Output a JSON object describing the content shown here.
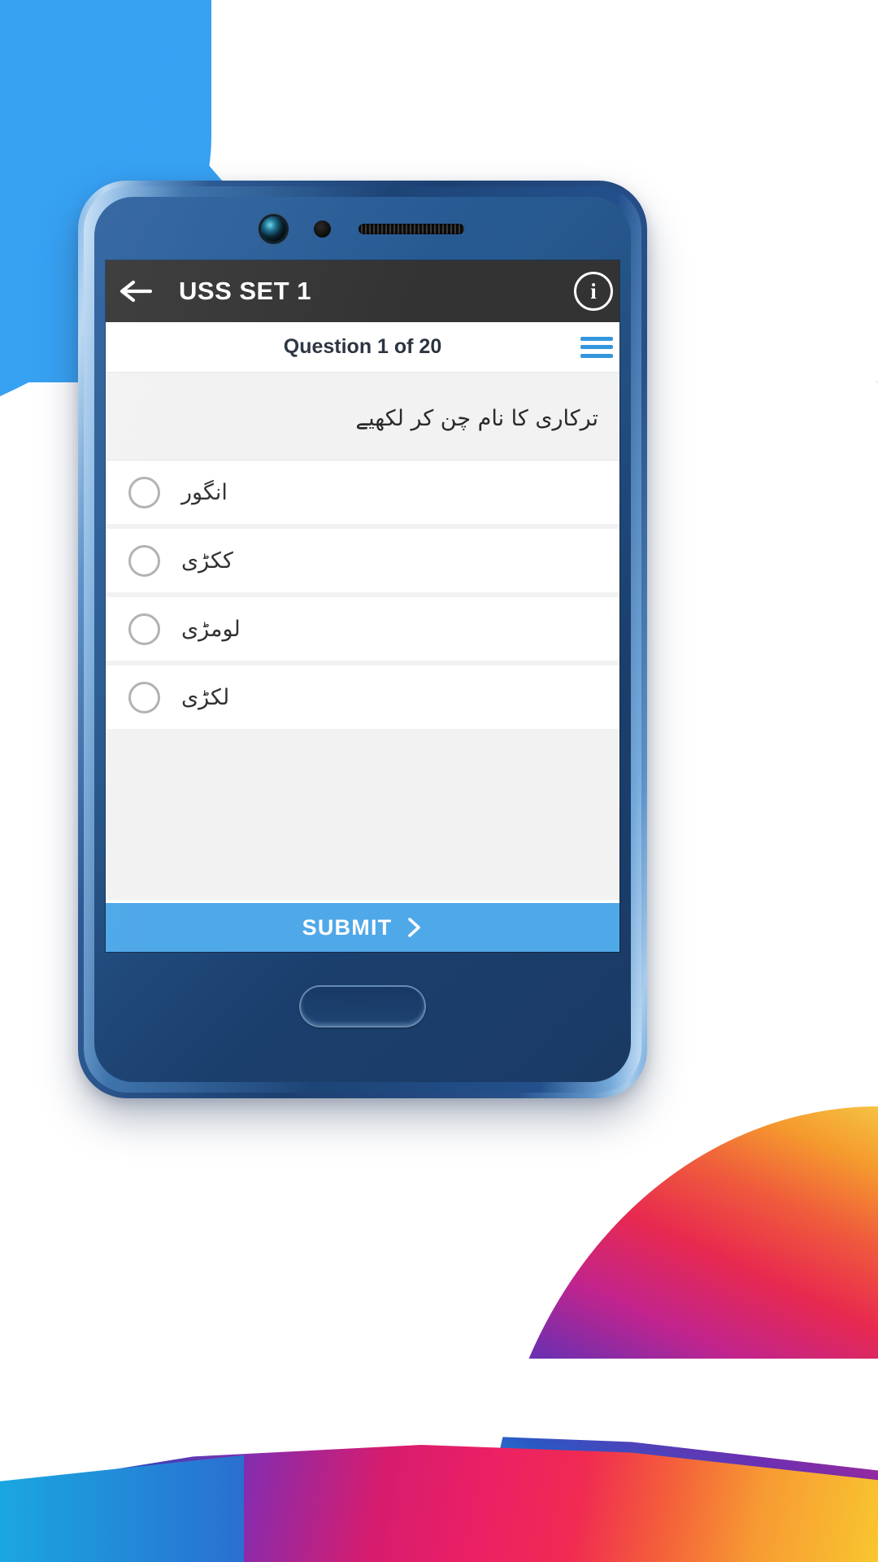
{
  "app": {
    "toolbar": {
      "back_icon": "arrow-left-icon",
      "title": "USS SET 1",
      "info_icon": "i",
      "background_color": "#333333"
    },
    "question_bar": {
      "counter_text": "Question 1 of 20",
      "menu_icon": "hamburger-icon",
      "menu_color": "#3397dd"
    },
    "question": {
      "text": "ترکاری کا نام چن کر لکھیے",
      "direction": "rtl"
    },
    "options": [
      {
        "id": "option-1",
        "label": "انگور",
        "selected": false
      },
      {
        "id": "option-2",
        "label": "ککڑی",
        "selected": false
      },
      {
        "id": "option-3",
        "label": "لومڑی",
        "selected": false
      },
      {
        "id": "option-4",
        "label": "لکڑی",
        "selected": false
      }
    ],
    "submit": {
      "label": "SUBMIT",
      "chevron_icon": "chevron-right-icon",
      "background_color": "#4fa8e8"
    }
  },
  "theme": {
    "page_blue": "#37a1f2",
    "accent_blue": "#3397dd",
    "toolbar_dark": "#333333",
    "panel_gray": "#f2f2f2"
  }
}
